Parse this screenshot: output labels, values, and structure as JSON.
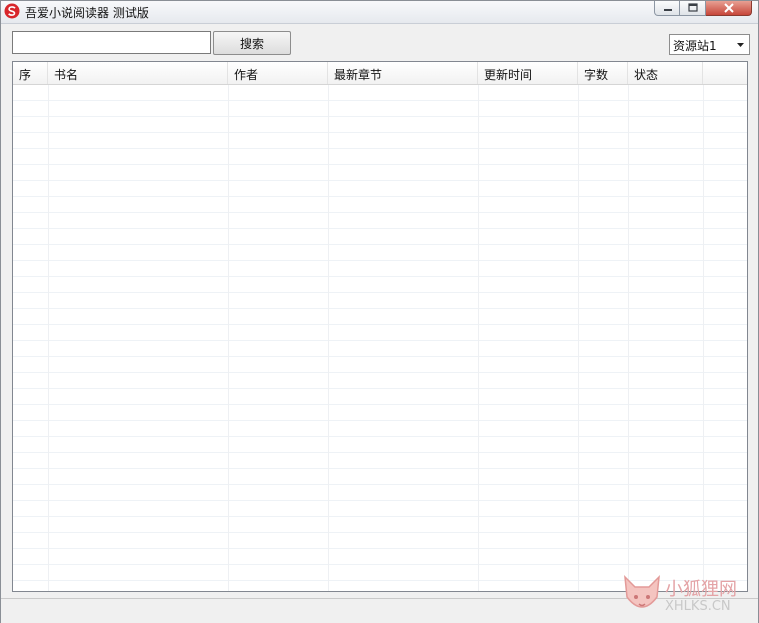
{
  "window": {
    "title": "吾爱小说阅读器 测试版"
  },
  "toolbar": {
    "search_value": "",
    "search_label": "搜索",
    "source_selected": "资源站1"
  },
  "table": {
    "columns": [
      "序",
      "书名",
      "作者",
      "最新章节",
      "更新时间",
      "字数",
      "状态"
    ],
    "rows": []
  },
  "watermark": {
    "line1": "小狐狸网",
    "line2": "XHLKS.CN"
  },
  "colors": {
    "accent_red": "#d8262b",
    "close_red": "#c7463a"
  }
}
